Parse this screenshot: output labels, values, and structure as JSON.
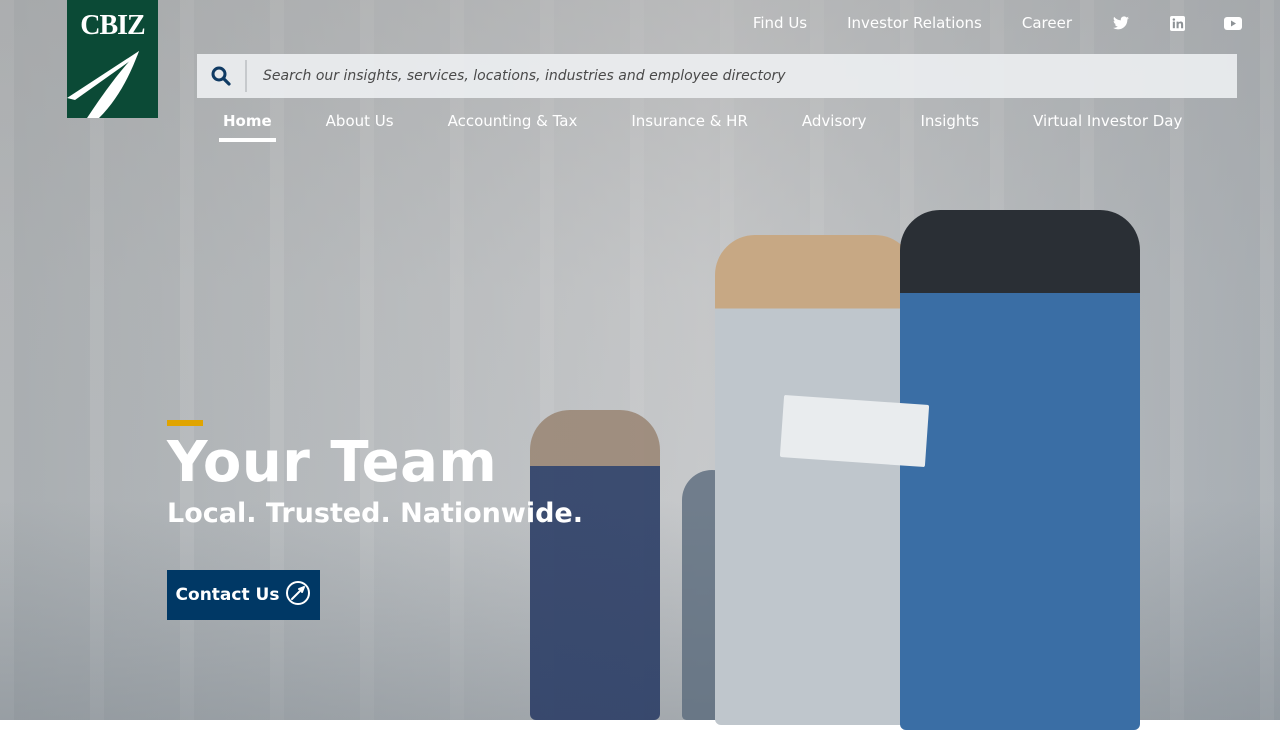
{
  "brand": {
    "logo_text": "CBIZ",
    "logo_color": "#0b4a36"
  },
  "utility_nav": {
    "links": [
      "Find Us",
      "Investor Relations",
      "Career"
    ],
    "social_icons": [
      "twitter-icon",
      "linkedin-icon",
      "youtube-icon"
    ]
  },
  "search": {
    "placeholder": "Search our insights, services, locations, industries and employee directory",
    "icon": "search-icon"
  },
  "main_nav": {
    "items": [
      "Home",
      "About Us",
      "Accounting & Tax",
      "Insurance & HR",
      "Advisory",
      "Insights",
      "Virtual Investor Day"
    ],
    "active": "Home"
  },
  "hero": {
    "title": "Your Team",
    "subtitle": "Local. Trusted. Nationwide.",
    "cta_label": "Contact Us",
    "cta_icon": "compass-arrow-icon",
    "accent_color": "#e0a400",
    "cta_color": "#003865"
  }
}
